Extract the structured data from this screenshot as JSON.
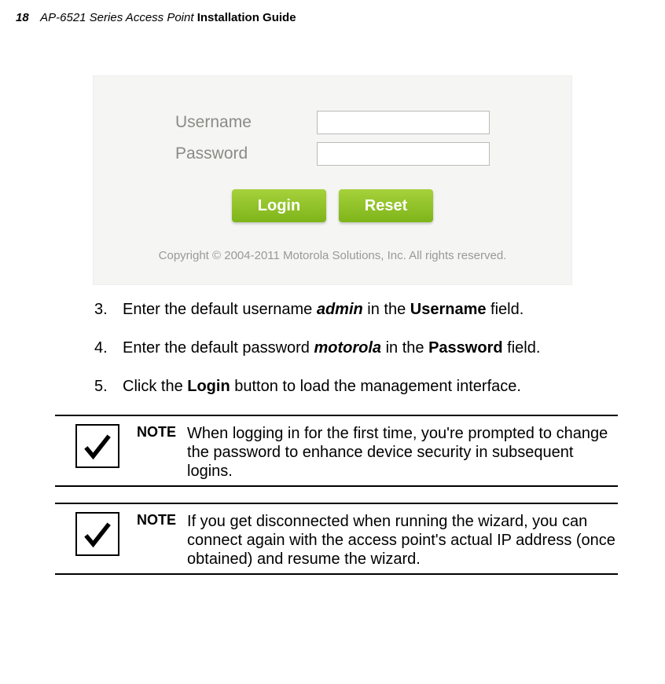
{
  "header": {
    "page_number": "18",
    "doc_title_italic": "AP-6521 Series Access Point ",
    "doc_title_bold": "Installation Guide"
  },
  "login_panel": {
    "username_label": "Username",
    "password_label": "Password",
    "username_value": "",
    "password_value": "",
    "login_button": "Login",
    "reset_button": "Reset",
    "copyright": "Copyright © 2004-2011 Motorola Solutions, Inc. All rights reserved."
  },
  "steps": [
    {
      "num": "3.",
      "prefix": "Enter the default username ",
      "bold1": "admin",
      "mid": " in the ",
      "bold2": "Username",
      "suffix": " field."
    },
    {
      "num": "4.",
      "prefix": "Enter the default password ",
      "bold1": "motorola",
      "mid": " in the ",
      "bold2": "Password",
      "suffix": " field."
    },
    {
      "num": "5.",
      "prefix": "Click the ",
      "bold1": "Login",
      "mid": "",
      "bold2": "",
      "suffix": " button to load the management interface."
    }
  ],
  "notes": [
    {
      "label": "NOTE",
      "text": "When logging in for the first time, you're prompted to change the password to enhance device security in subsequent logins."
    },
    {
      "label": "NOTE",
      "text": "If you get disconnected when running the wizard, you can connect again with the access point's actual IP address (once obtained) and resume the wizard."
    }
  ]
}
